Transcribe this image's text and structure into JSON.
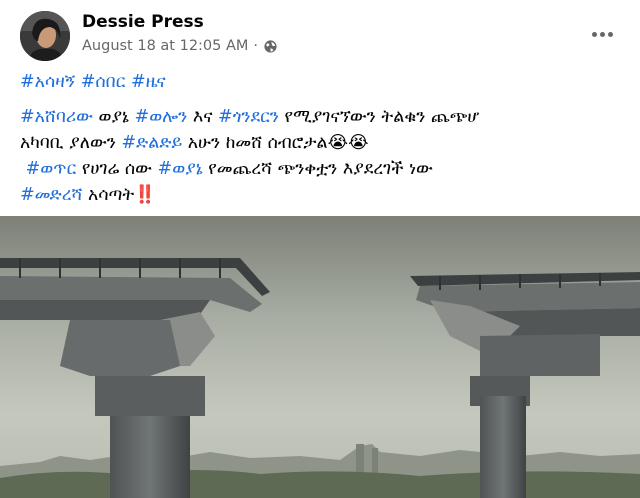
{
  "post": {
    "author": "Dessie Press",
    "timestamp": "August 18 at 12:05 AM",
    "separator": "·",
    "privacy_icon": "globe-icon",
    "more_icon": "more-options-icon",
    "tags_line": [
      "#አሳዛኝ",
      "#ሰበር",
      "#ዜና"
    ],
    "body": {
      "l1_t1": "#አሸባሪው",
      "l1_s1": " ወያኔ ",
      "l1_t2": "#ወሎን",
      "l1_s2": " እና ",
      "l1_t3": "#ጎንደርን",
      "l1_s3": " የሚያገናኘውን ትልቁን ጨጭሆ",
      "l2_s1": "አካባቢ ያለውን ",
      "l2_t1": "#ድልድይ",
      "l2_s2": " አሁን ከመሸ ሰብሮታል😭😭",
      "l3_t1": "#ወጥር",
      "l3_s1": " የሀገሬ ሰው ",
      "l3_t2": "#ወያኔ",
      "l3_s2": " የመጨረሻ ጭንቀቷን እያደረገች ነው",
      "l4_t1": "#መድረሻ",
      "l4_s1": " አሳጣት‼️"
    },
    "colors": {
      "link": "#216fdb",
      "meta": "#65676b",
      "text": "#050505"
    }
  }
}
